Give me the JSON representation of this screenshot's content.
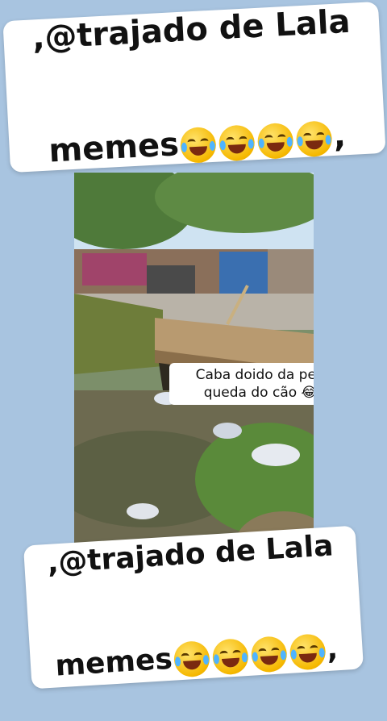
{
  "top_banner": {
    "line1": ",@trajado de Lala",
    "line2_text": "memes",
    "line2_suffix": ",",
    "emoji_icon": "face-with-tears-of-joy-icon",
    "emoji_count": 4
  },
  "caption": {
    "text": "Caba doido da peste,\nqueda do cão 😂😂"
  },
  "bottom_banner": {
    "line1": ",@trajado de Lala",
    "line2_text": "memes",
    "line2_suffix": ",",
    "emoji_icon": "face-with-tears-of-joy-icon",
    "emoji_count": 4
  },
  "colors": {
    "background": "#a8c4e0",
    "banner": "#ffffff",
    "text": "#111111"
  }
}
